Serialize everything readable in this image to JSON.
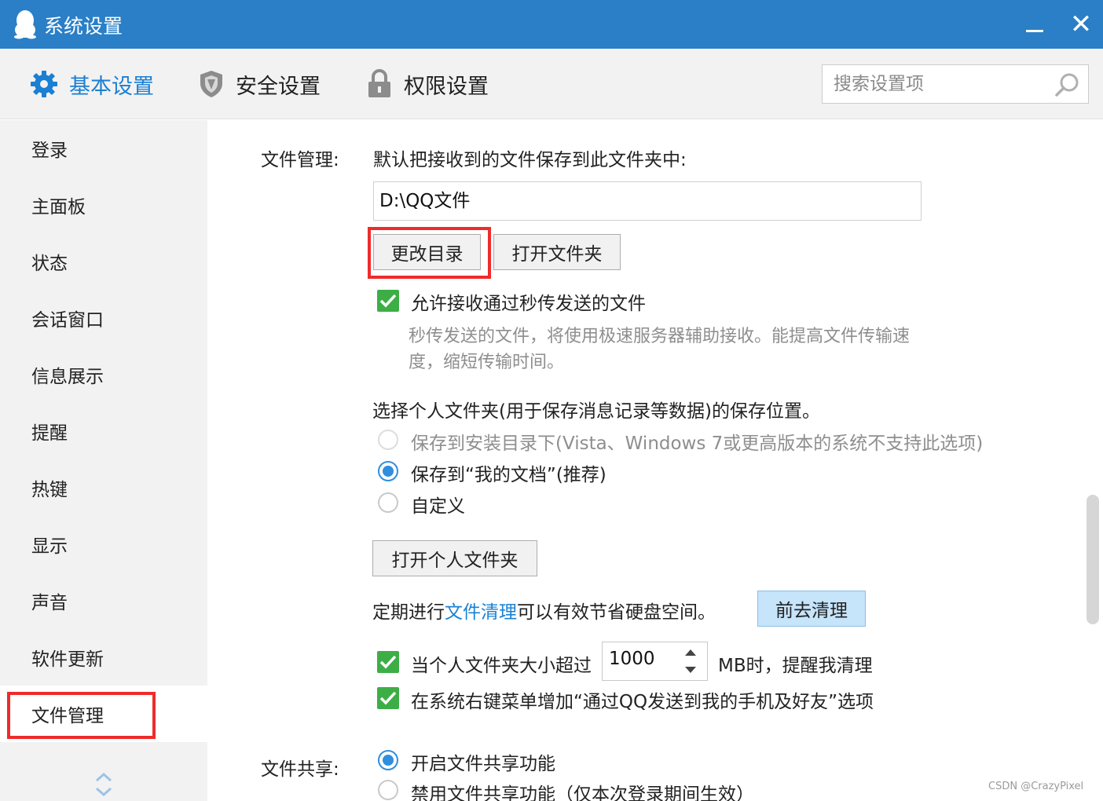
{
  "window": {
    "title": "系统设置",
    "close_glyph": "✕"
  },
  "tabs": [
    {
      "label": "基本设置",
      "icon": "gear-icon",
      "active": true
    },
    {
      "label": "安全设置",
      "icon": "shield-icon",
      "active": false
    },
    {
      "label": "权限设置",
      "icon": "lock-icon",
      "active": false
    }
  ],
  "search": {
    "placeholder": "搜索设置项"
  },
  "sidebar": {
    "items": [
      {
        "label": "登录"
      },
      {
        "label": "主面板"
      },
      {
        "label": "状态"
      },
      {
        "label": "会话窗口"
      },
      {
        "label": "信息展示"
      },
      {
        "label": "提醒"
      },
      {
        "label": "热键"
      },
      {
        "label": "显示"
      },
      {
        "label": "声音"
      },
      {
        "label": "软件更新"
      },
      {
        "label": "文件管理",
        "active": true
      }
    ]
  },
  "file_management": {
    "section_label": "文件管理:",
    "default_save_text": "默认把接收到的文件保存到此文件夹中:",
    "path_value": "D:\\QQ文件",
    "change_dir_button": "更改目录",
    "open_folder_button": "打开文件夹",
    "allow_instant_checkbox": "允许接收通过秒传发送的文件",
    "allow_instant_desc_line1": "秒传发送的文件，将使用极速服务器辅助接收。能提高文件传输速",
    "allow_instant_desc_line2": "度，缩短传输时间。",
    "personal_folder_prompt": "选择个人文件夹(用于保存消息记录等数据)的保存位置。",
    "radio_install_dir": "保存到安装目录下(Vista、Windows 7或更高版本的系统不支持此选项)",
    "radio_my_documents": "保存到“我的文档”(推荐)",
    "radio_custom": "自定义",
    "open_personal_button": "打开个人文件夹",
    "cleanup_prefix": "定期进行",
    "cleanup_link": "文件清理",
    "cleanup_suffix": "可以有效节省硬盘空间。",
    "cleanup_button": "前去清理",
    "size_alert_prefix": "当个人文件夹大小超过",
    "size_alert_value": "1000",
    "size_alert_suffix": "MB时，提醒我清理",
    "context_menu_checkbox": "在系统右键菜单增加“通过QQ发送到我的手机及好友”选项"
  },
  "file_sharing": {
    "section_label": "文件共享:",
    "enable_radio": "开启文件共享功能",
    "disable_radio": "禁用文件共享功能（仅本次登录期间生效）"
  },
  "watermark": "CSDN @CrazyPixel",
  "colors": {
    "titlebar": "#2a7fc6",
    "accent": "#1b7fd3",
    "highlight_border": "#ef2b2b",
    "checkbox": "#3dae46"
  }
}
